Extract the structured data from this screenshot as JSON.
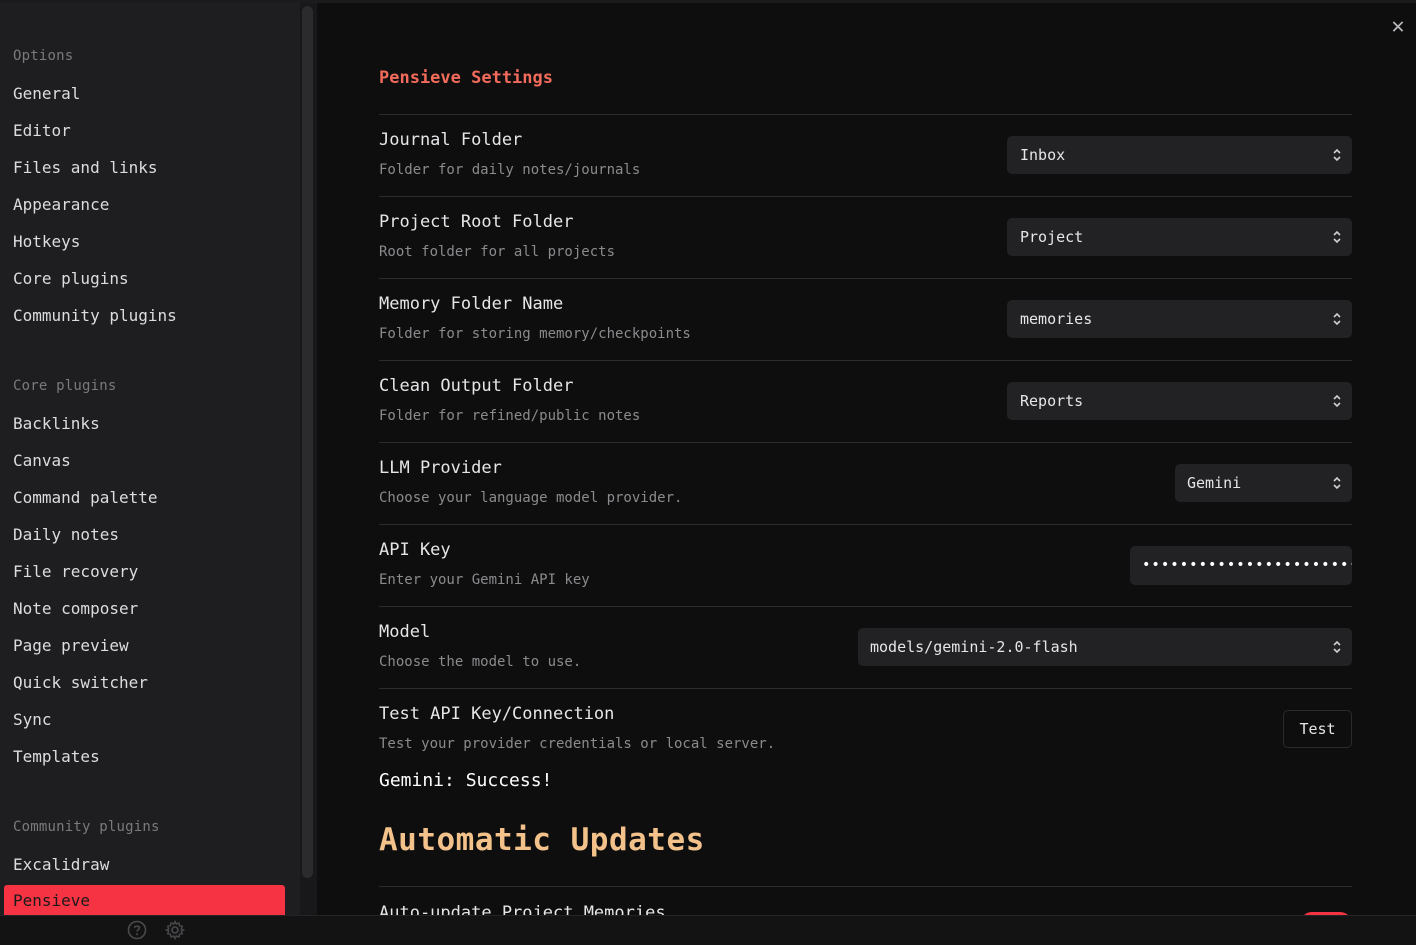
{
  "sidebar": {
    "options_header": "Options",
    "options": [
      "General",
      "Editor",
      "Files and links",
      "Appearance",
      "Hotkeys",
      "Core plugins",
      "Community plugins"
    ],
    "core_header": "Core plugins",
    "core": [
      "Backlinks",
      "Canvas",
      "Command palette",
      "Daily notes",
      "File recovery",
      "Note composer",
      "Page preview",
      "Quick switcher",
      "Sync",
      "Templates"
    ],
    "community_header": "Community plugins",
    "community": [
      "Excalidraw",
      "Pensieve"
    ],
    "active_item": "Pensieve"
  },
  "bottombar": {
    "help_icon": "help-circle-icon",
    "settings_icon": "gear-icon"
  },
  "main": {
    "close_icon": "close-icon",
    "title": "Pensieve Settings",
    "settings": [
      {
        "name": "Journal Folder",
        "desc": "Folder for daily notes/journals",
        "control": "select",
        "value": "Inbox"
      },
      {
        "name": "Project Root Folder",
        "desc": "Root folder for all projects",
        "control": "select",
        "value": "Project"
      },
      {
        "name": "Memory Folder Name",
        "desc": "Folder for storing memory/checkpoints",
        "control": "select",
        "value": "memories"
      },
      {
        "name": "Clean Output Folder",
        "desc": "Folder for refined/public notes",
        "control": "select",
        "value": "Reports"
      },
      {
        "name": "LLM Provider",
        "desc": "Choose your language model provider.",
        "control": "select",
        "value": "Gemini"
      },
      {
        "name": "API Key",
        "desc": "Enter your Gemini API key",
        "control": "password",
        "value": "••••••••••••••••••••••••"
      },
      {
        "name": "Model",
        "desc": "Choose the model to use.",
        "control": "select",
        "value": "models/gemini-2.0-flash"
      },
      {
        "name": "Test API Key/Connection",
        "desc": "Test your provider credentials or local server.",
        "control": "button",
        "value": "Test"
      }
    ],
    "status": "Gemini: Success!",
    "section_title": "Automatic Updates",
    "next_setting": "Auto-update Project Memories"
  },
  "colors": {
    "accent": "#f53342",
    "title": "#f26b5b",
    "section": "#f3c18a"
  }
}
